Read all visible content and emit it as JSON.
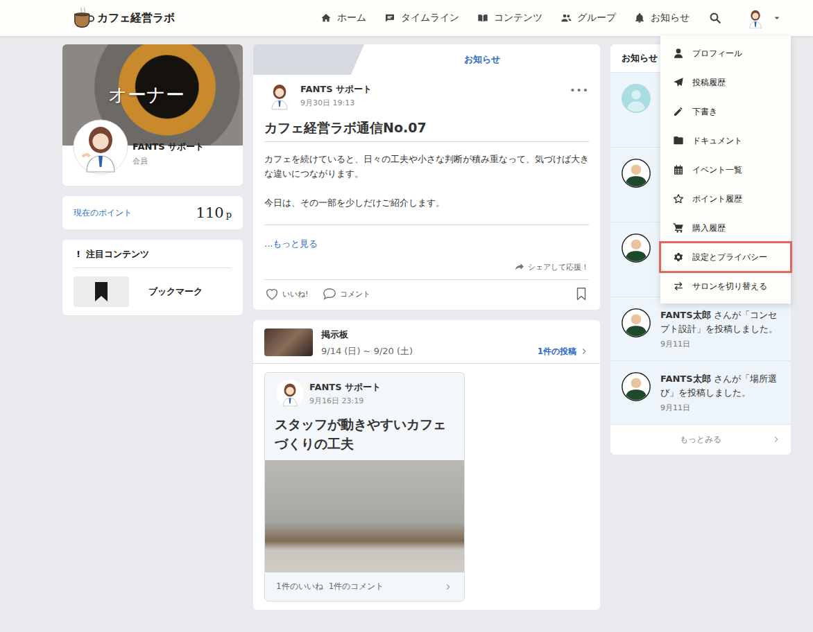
{
  "header": {
    "logo": "カフェ経営ラボ",
    "nav": [
      {
        "label": "ホーム"
      },
      {
        "label": "タイムライン"
      },
      {
        "label": "コンテンツ"
      },
      {
        "label": "グループ"
      },
      {
        "label": "お知らせ"
      }
    ],
    "account_menu_open": true
  },
  "profile": {
    "cover_label": "オーナー",
    "name": "FANTS サポート",
    "role": "会員"
  },
  "points": {
    "label": "現在のポイント",
    "value": "110",
    "unit": "p"
  },
  "featured": {
    "mark": "!",
    "title": "注目コンテンツ",
    "items": [
      {
        "label": "ブックマーク"
      }
    ]
  },
  "post": {
    "tab": "お知らせ",
    "author": "FANTS サポート",
    "time": "9月30日 19:13",
    "menu": "•••",
    "title": "カフェ経営ラボ通信No.07",
    "paragraphs": [
      "カフェを続けていると、日々の工夫や小さな判断が積み重なって、気づけば大きな違いにつながります。",
      "今日は、その一部を少しだけご紹介します。"
    ],
    "more": "...もっと見る",
    "share": "シェアして応援！",
    "like": "いいね!",
    "comment": "コメント",
    "liked": false,
    "bookmarked": false
  },
  "board": {
    "title": "掲示板",
    "range": "9/14 (日) ~ 9/20 (土)",
    "count": "1件の投稿",
    "entry": {
      "author": "FANTS サポート",
      "time": "9月16日 23:19",
      "title": "スタッフが動きやすいカフェづくりの工夫",
      "likes": "1件のいいね",
      "comments": "1件のコメント"
    }
  },
  "notifications": {
    "title": "お知らせ",
    "items": [
      {
        "kind": "system",
        "unread": true
      },
      {
        "kind": "member",
        "unread": true
      },
      {
        "kind": "member",
        "unread": true
      },
      {
        "kind": "member",
        "unread": true,
        "actor": "FANTS太郎",
        "message": "さんが「コンセプト設計」を投稿しました。",
        "date": "9月11日"
      },
      {
        "kind": "member",
        "unread": true,
        "actor": "FANTS太郎",
        "message": "さんが「場所選び」を投稿しました。",
        "date": "9月11日"
      }
    ],
    "more": "もっとみる"
  },
  "account_menu": {
    "items": [
      {
        "label": "プロフィール",
        "highlighted": false
      },
      {
        "label": "投稿履歴",
        "highlighted": false
      },
      {
        "label": "下書き",
        "highlighted": false
      },
      {
        "label": "ドキュメント",
        "highlighted": false
      },
      {
        "label": "イベント一覧",
        "highlighted": false
      },
      {
        "label": "ポイント履歴",
        "highlighted": false
      },
      {
        "label": "購入履歴",
        "highlighted": false
      },
      {
        "label": "設定とプライバシー",
        "highlighted": true
      },
      {
        "label": "サロンを切り替える",
        "highlighted": false
      }
    ]
  }
}
